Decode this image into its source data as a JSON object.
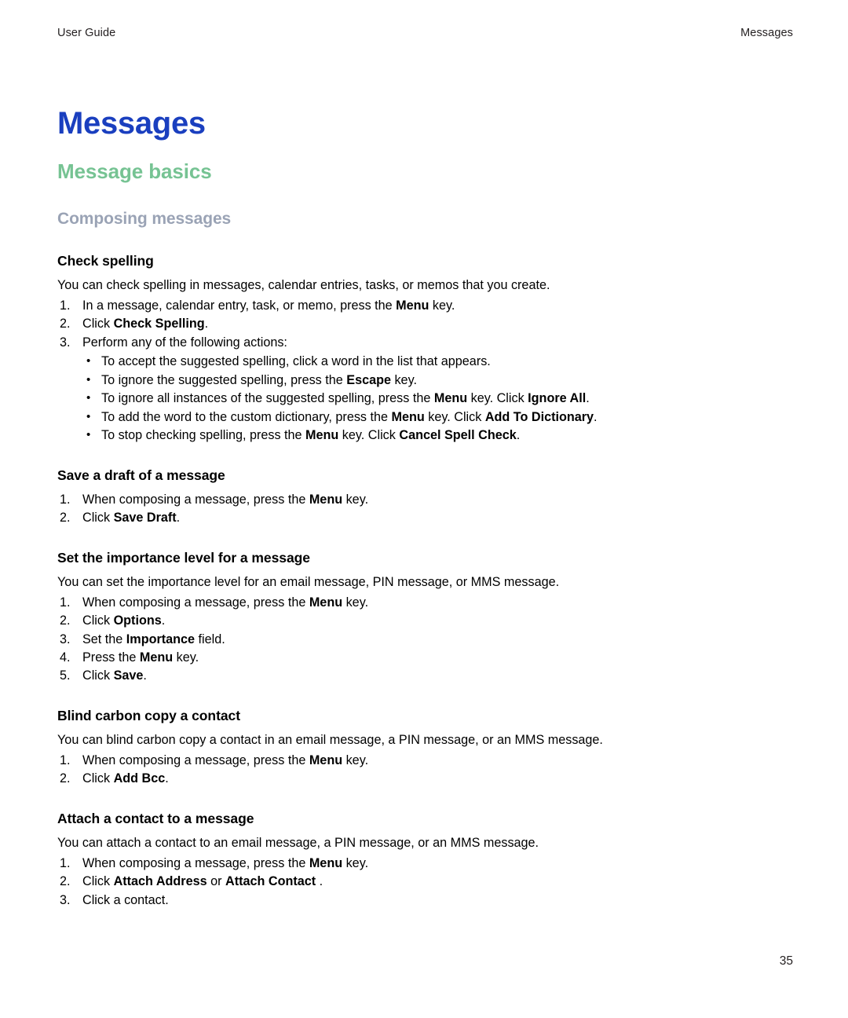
{
  "header": {
    "left": "User Guide",
    "right": "Messages"
  },
  "titles": {
    "chapter": "Messages",
    "section": "Message basics",
    "subsection": "Composing messages"
  },
  "colors": {
    "chapter": "#1a3fbf",
    "section": "#76c393",
    "subsection": "#9aa3b5",
    "body": "#000000"
  },
  "tasks": [
    {
      "title": "Check spelling",
      "intro": "You can check spelling in messages, calendar entries, tasks, or memos that you create.",
      "steps": [
        {
          "marker": "1.",
          "parts": [
            {
              "t": "In a message, calendar entry, task, or memo, press the "
            },
            {
              "t": "Menu",
              "b": true
            },
            {
              "t": " key."
            }
          ]
        },
        {
          "marker": "2.",
          "parts": [
            {
              "t": "Click "
            },
            {
              "t": "Check Spelling",
              "b": true
            },
            {
              "t": "."
            }
          ]
        },
        {
          "marker": "3.",
          "parts": [
            {
              "t": "Perform any of the following actions:"
            }
          ]
        }
      ],
      "bullets": [
        [
          {
            "t": "To accept the suggested spelling, click a word in the list that appears."
          }
        ],
        [
          {
            "t": "To ignore the suggested spelling, press the "
          },
          {
            "t": "Escape",
            "b": true
          },
          {
            "t": " key."
          }
        ],
        [
          {
            "t": "To ignore all instances of the suggested spelling, press the "
          },
          {
            "t": "Menu",
            "b": true
          },
          {
            "t": " key. Click "
          },
          {
            "t": "Ignore All",
            "b": true
          },
          {
            "t": "."
          }
        ],
        [
          {
            "t": "To add the word to the custom dictionary, press the "
          },
          {
            "t": "Menu",
            "b": true
          },
          {
            "t": " key. Click "
          },
          {
            "t": "Add To Dictionary",
            "b": true
          },
          {
            "t": "."
          }
        ],
        [
          {
            "t": "To stop checking spelling, press the "
          },
          {
            "t": "Menu",
            "b": true
          },
          {
            "t": " key. Click "
          },
          {
            "t": "Cancel Spell Check",
            "b": true
          },
          {
            "t": "."
          }
        ]
      ]
    },
    {
      "title": "Save a draft of a message",
      "intro": null,
      "steps": [
        {
          "marker": "1.",
          "parts": [
            {
              "t": "When composing a message, press the "
            },
            {
              "t": "Menu",
              "b": true
            },
            {
              "t": " key."
            }
          ]
        },
        {
          "marker": "2.",
          "parts": [
            {
              "t": "Click "
            },
            {
              "t": "Save Draft",
              "b": true
            },
            {
              "t": "."
            }
          ]
        }
      ],
      "bullets": []
    },
    {
      "title": "Set the importance level for a message",
      "intro": "You can set the importance level for an email message, PIN message, or MMS message.",
      "steps": [
        {
          "marker": "1.",
          "parts": [
            {
              "t": "When composing a message, press the "
            },
            {
              "t": "Menu",
              "b": true
            },
            {
              "t": " key."
            }
          ]
        },
        {
          "marker": "2.",
          "parts": [
            {
              "t": "Click "
            },
            {
              "t": "Options",
              "b": true
            },
            {
              "t": "."
            }
          ]
        },
        {
          "marker": "3.",
          "parts": [
            {
              "t": "Set the "
            },
            {
              "t": "Importance",
              "b": true
            },
            {
              "t": " field."
            }
          ]
        },
        {
          "marker": "4.",
          "parts": [
            {
              "t": "Press the "
            },
            {
              "t": "Menu",
              "b": true
            },
            {
              "t": " key."
            }
          ]
        },
        {
          "marker": "5.",
          "parts": [
            {
              "t": "Click "
            },
            {
              "t": "Save",
              "b": true
            },
            {
              "t": "."
            }
          ]
        }
      ],
      "bullets": []
    },
    {
      "title": "Blind carbon copy a contact",
      "intro": "You can blind carbon copy a contact in an email message, a PIN message, or an MMS message.",
      "steps": [
        {
          "marker": "1.",
          "parts": [
            {
              "t": "When composing a message, press the "
            },
            {
              "t": "Menu",
              "b": true
            },
            {
              "t": " key."
            }
          ]
        },
        {
          "marker": "2.",
          "parts": [
            {
              "t": "Click "
            },
            {
              "t": "Add Bcc",
              "b": true
            },
            {
              "t": "."
            }
          ]
        }
      ],
      "bullets": []
    },
    {
      "title": "Attach a contact to a message",
      "intro": "You can attach a contact to an email message, a PIN message, or an MMS message.",
      "steps": [
        {
          "marker": "1.",
          "parts": [
            {
              "t": "When composing a message, press the "
            },
            {
              "t": "Menu",
              "b": true
            },
            {
              "t": " key."
            }
          ]
        },
        {
          "marker": "2.",
          "parts": [
            {
              "t": "Click "
            },
            {
              "t": "Attach Address",
              "b": true
            },
            {
              "t": " or "
            },
            {
              "t": "Attach Contact",
              "b": true
            },
            {
              "t": " ."
            }
          ]
        },
        {
          "marker": "3.",
          "parts": [
            {
              "t": "Click a contact."
            }
          ]
        }
      ],
      "bullets": []
    }
  ],
  "page_number": "35"
}
